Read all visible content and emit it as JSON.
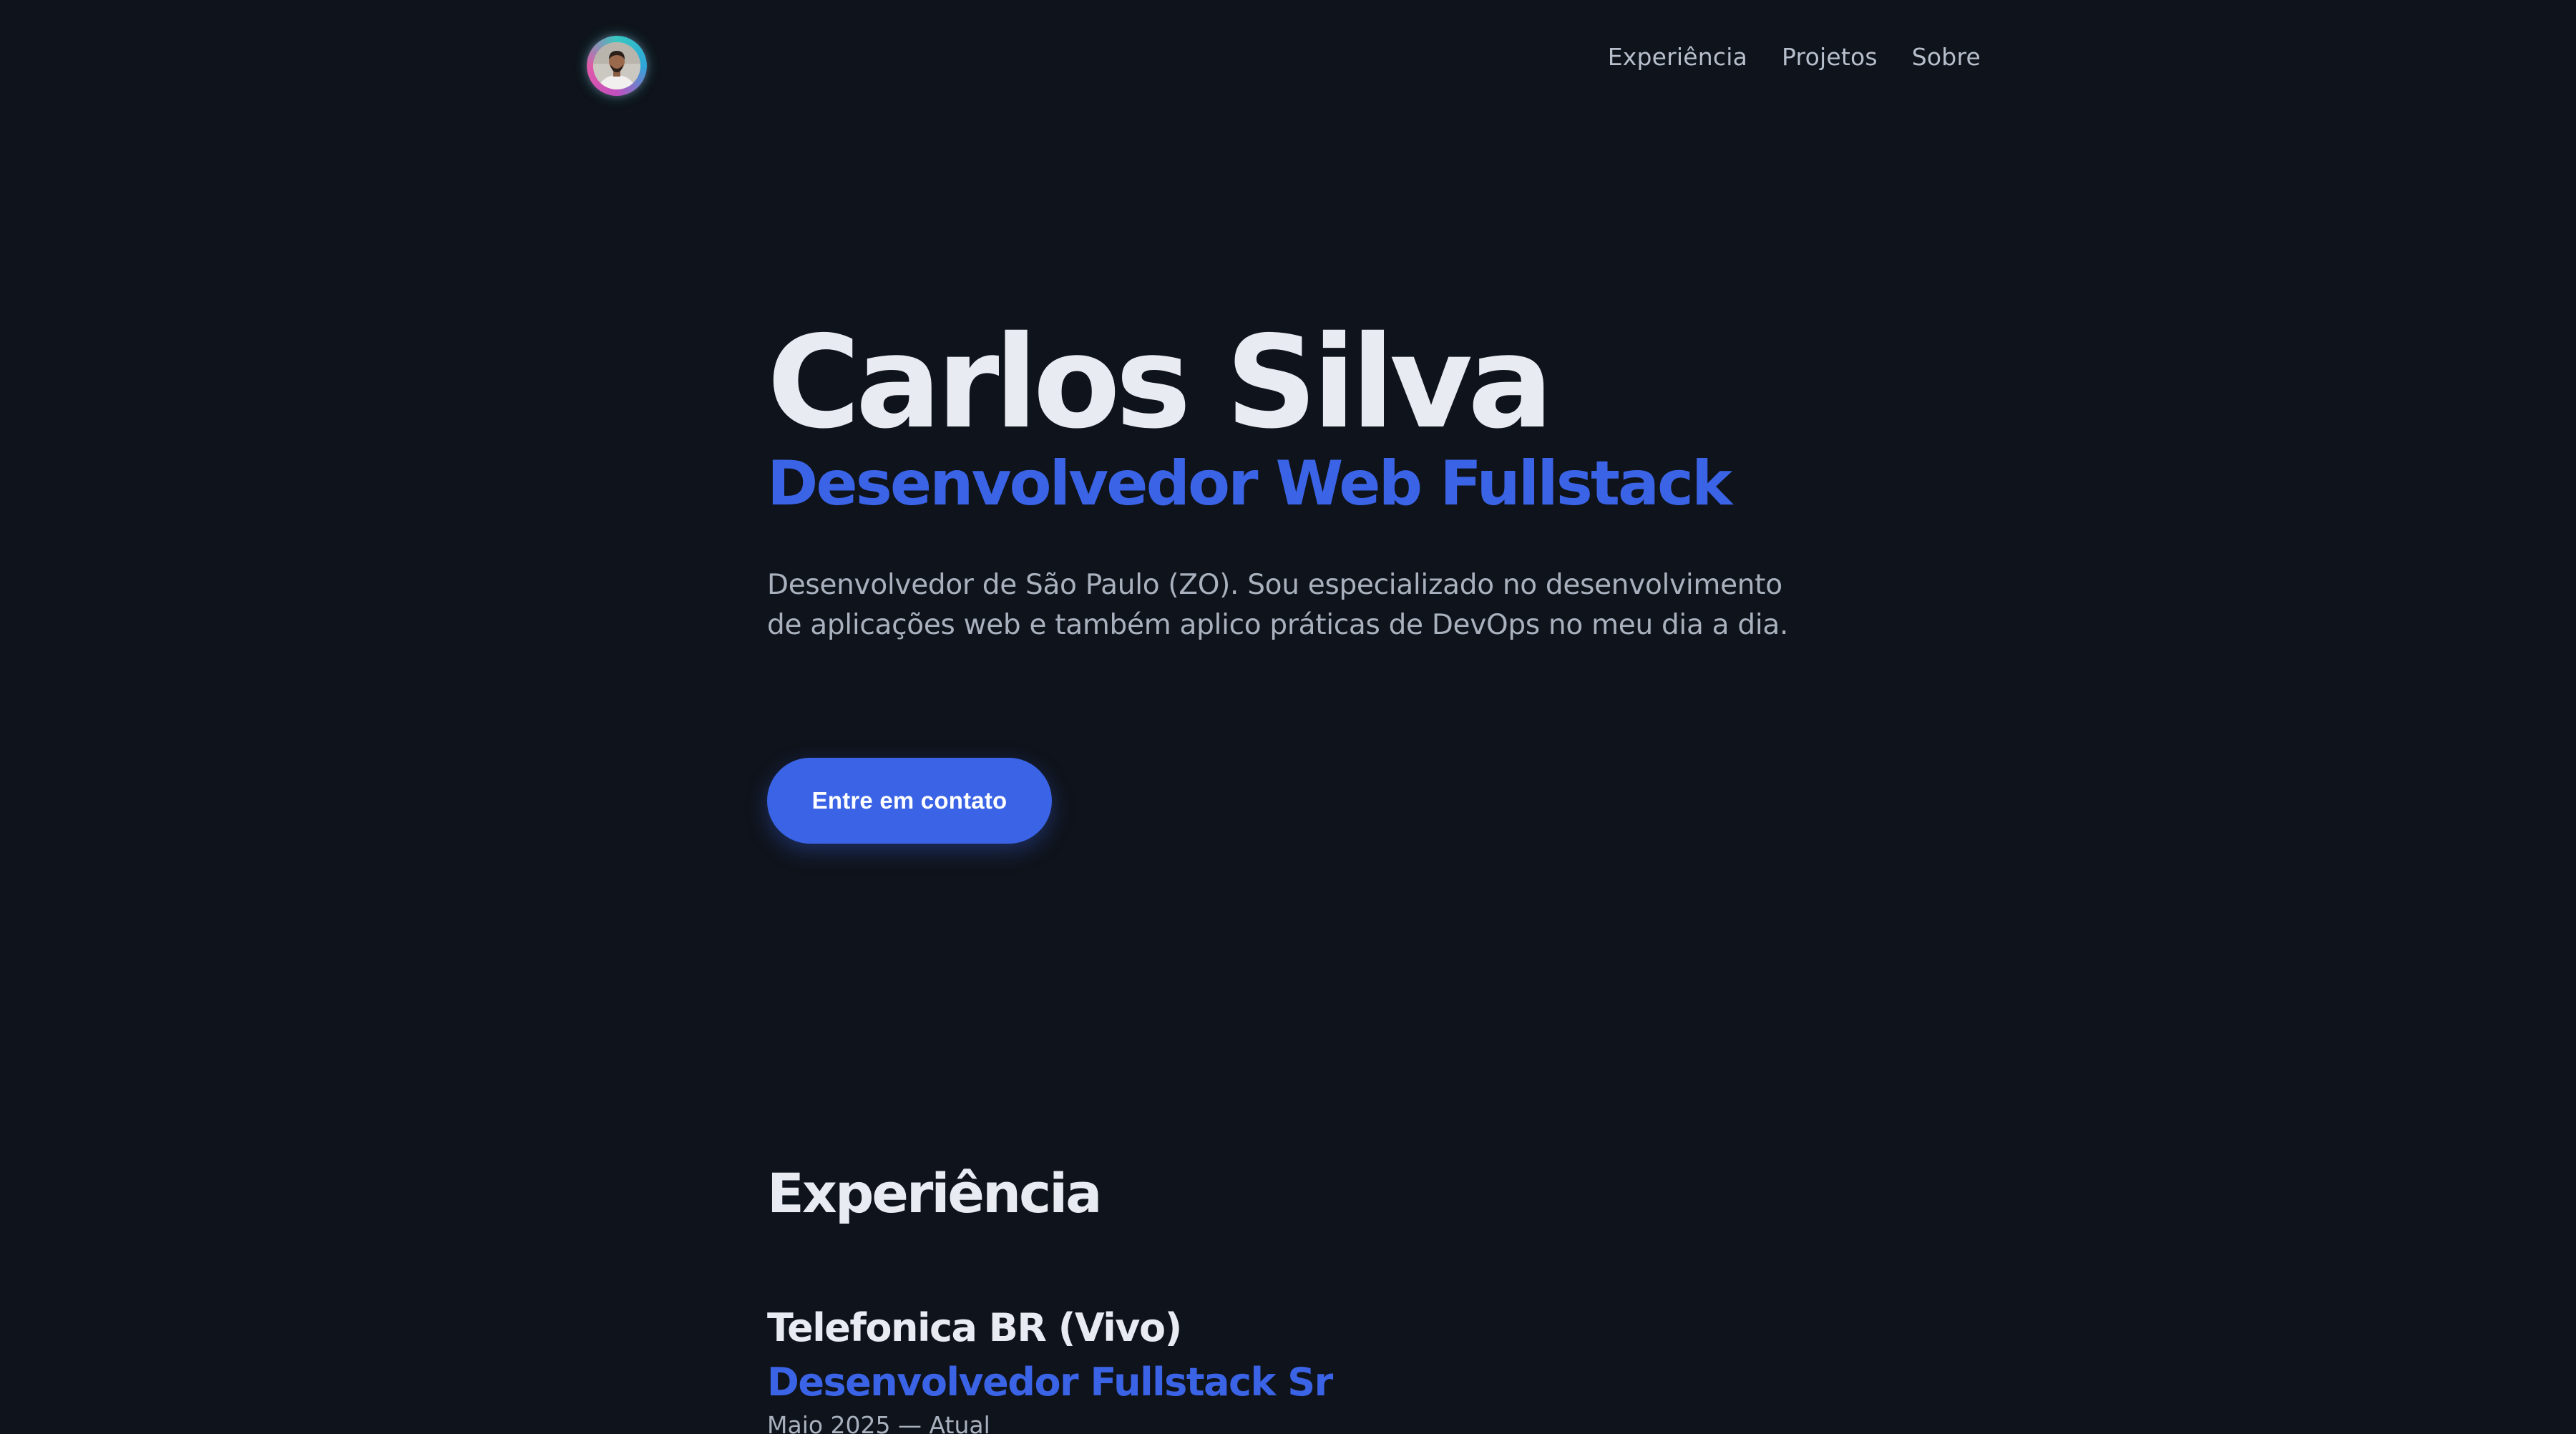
{
  "header": {
    "avatar_alt": "Carlos Silva",
    "nav": [
      {
        "label": "Experiência"
      },
      {
        "label": "Projetos"
      },
      {
        "label": "Sobre"
      }
    ]
  },
  "hero": {
    "name": "Carlos Silva",
    "role": "Desenvolvedor Web Fullstack",
    "description": "Desenvolvedor de São Paulo (ZO). Sou especializado no desenvolvimento de aplicações web e também aplico práticas de DevOps no meu dia a dia.",
    "cta_label": "Entre em contato"
  },
  "experience": {
    "title": "Experiência",
    "items": [
      {
        "company": "Telefonica BR (Vivo)",
        "position": "Desenvolvedor Fullstack Sr",
        "dates": "Maio 2025 — Atual"
      }
    ]
  },
  "colors": {
    "background": "#0f131b",
    "accent": "#3a63e6",
    "heading": "#e8ebf1",
    "muted_text": "#a9b1be",
    "avatar_ring": [
      "#36c7c2",
      "#e05aa8"
    ]
  }
}
